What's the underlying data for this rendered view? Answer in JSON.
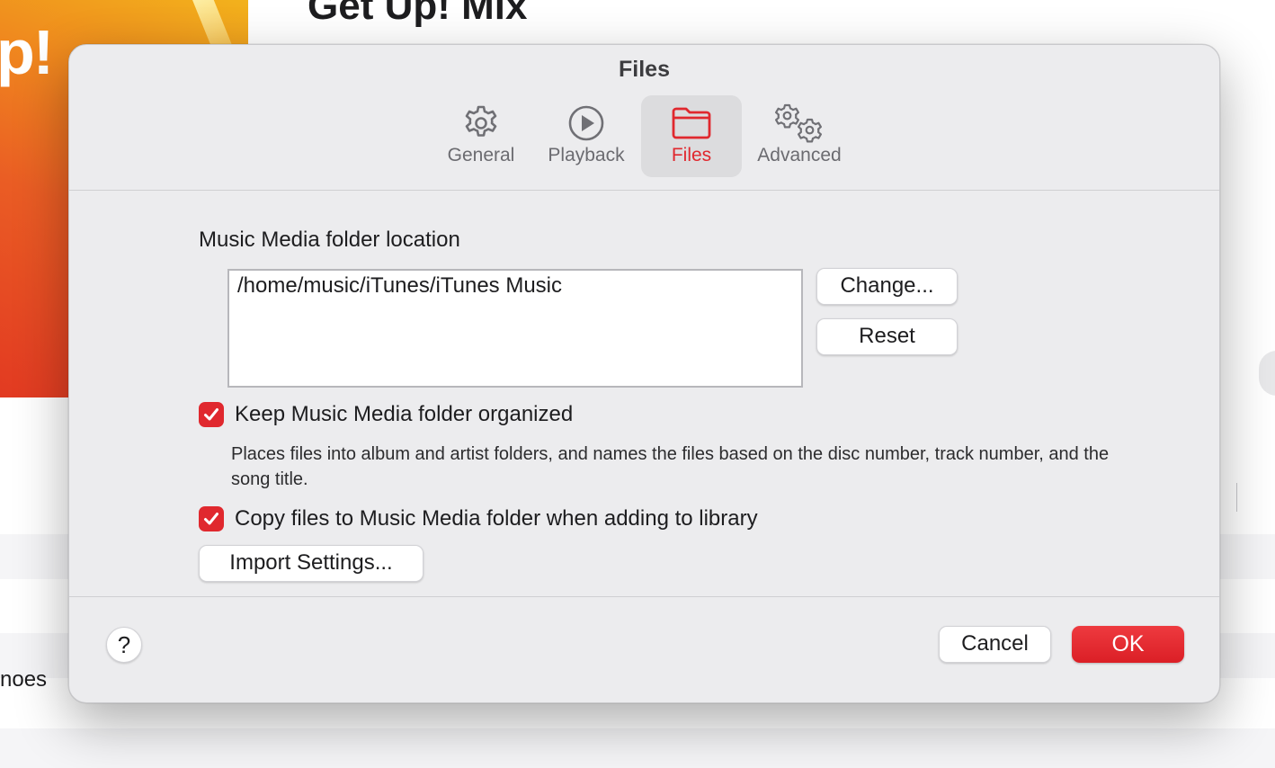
{
  "background": {
    "album_title": "Get Up! Mix",
    "art_text": "p!",
    "row_text": "noes"
  },
  "dialog": {
    "title": "Files",
    "tabs": [
      {
        "label": "General",
        "icon": "gear-icon",
        "active": false
      },
      {
        "label": "Playback",
        "icon": "play-circle-icon",
        "active": false
      },
      {
        "label": "Files",
        "icon": "folder-icon",
        "active": true
      },
      {
        "label": "Advanced",
        "icon": "gears-icon",
        "active": false
      }
    ],
    "folder_section_label": "Music Media folder location",
    "folder_path": "/home/music/iTunes/iTunes Music",
    "change_button": "Change...",
    "reset_button": "Reset",
    "keep_organized": {
      "label": "Keep Music Media folder organized",
      "checked": true,
      "description": "Places files into album and artist folders, and names the files based on the disc number, track number, and the song title."
    },
    "copy_files": {
      "label": "Copy files to Music Media folder when adding to library",
      "checked": true
    },
    "import_settings_button": "Import Settings...",
    "help_button": "?",
    "cancel_button": "Cancel",
    "ok_button": "OK"
  },
  "colors": {
    "accent": "#e0282e",
    "dialog_bg": "#ececee",
    "active_tab_bg": "#dcdcde"
  }
}
